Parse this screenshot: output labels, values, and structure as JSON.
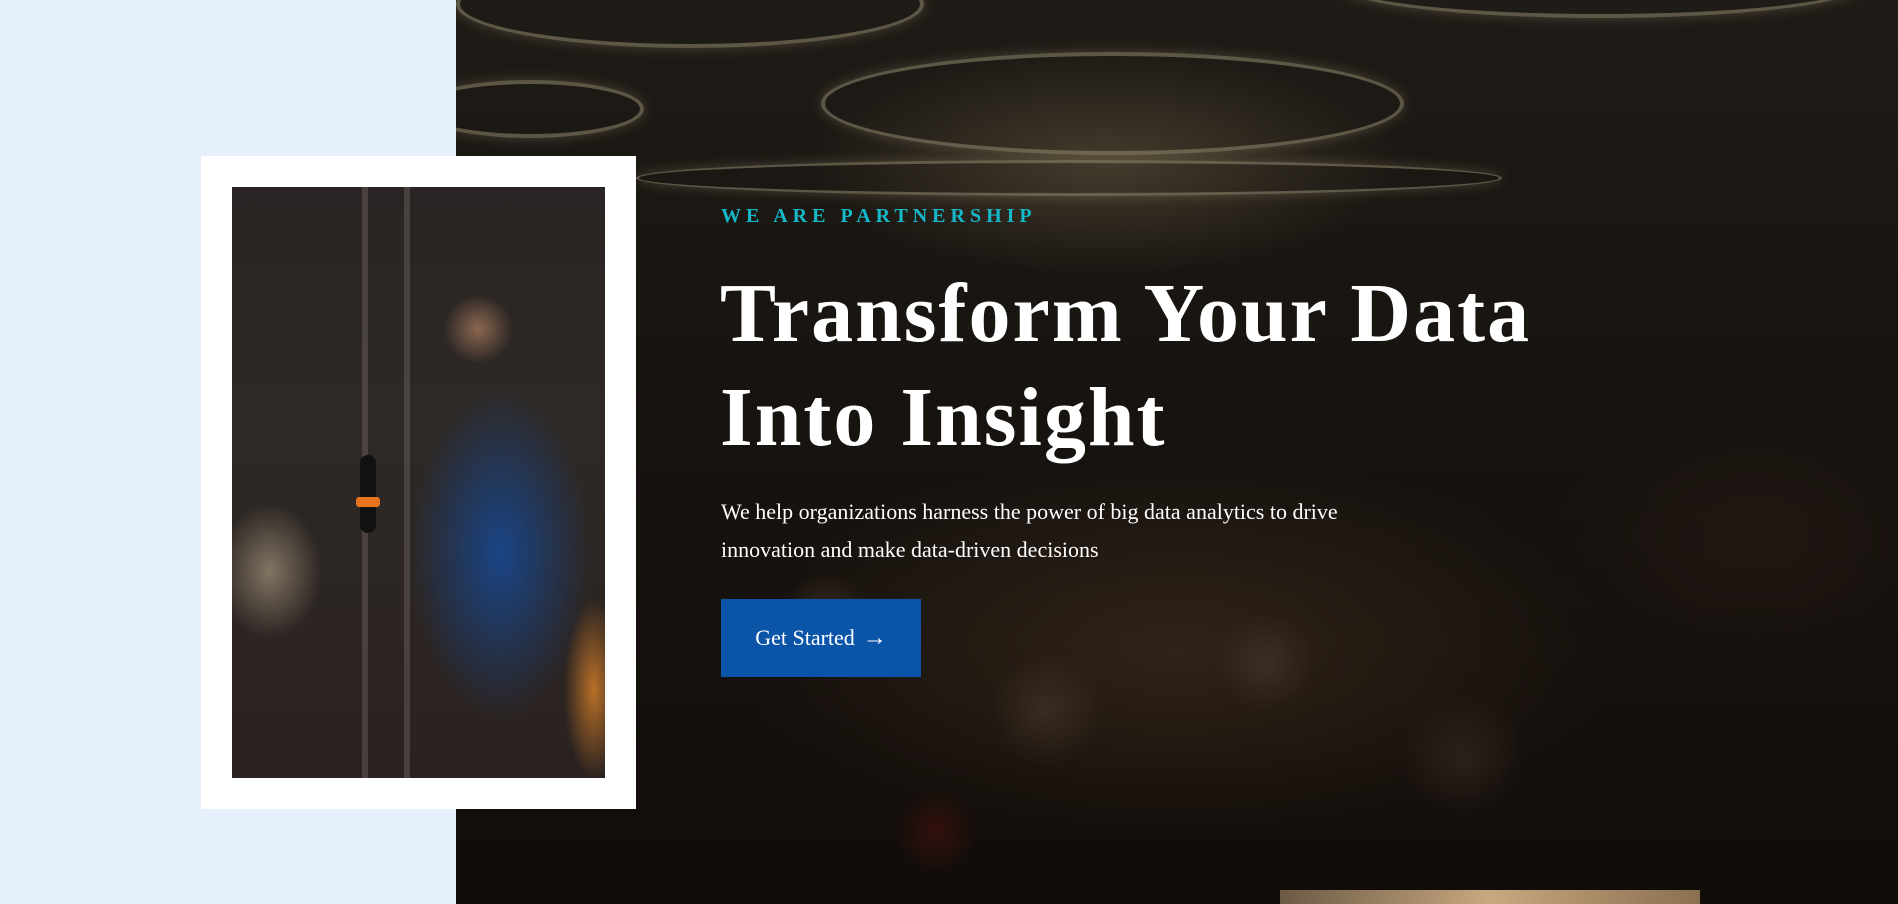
{
  "hero": {
    "eyebrow": "WE ARE PARTNERSHIP",
    "headline_line1": "Transform Your Data",
    "headline_line2": "Into Insight",
    "subtitle_line1": "We help organizations harness the power of big data analytics to drive",
    "subtitle_line2": "innovation and make data-driven decisions",
    "cta_label": "Get Started",
    "cta_icon": "arrow-right-icon"
  },
  "colors": {
    "page_background": "#e6f0fc",
    "eyebrow": "#14b8c8",
    "cta_background": "#0b55a8",
    "headline": "#ffffff"
  }
}
